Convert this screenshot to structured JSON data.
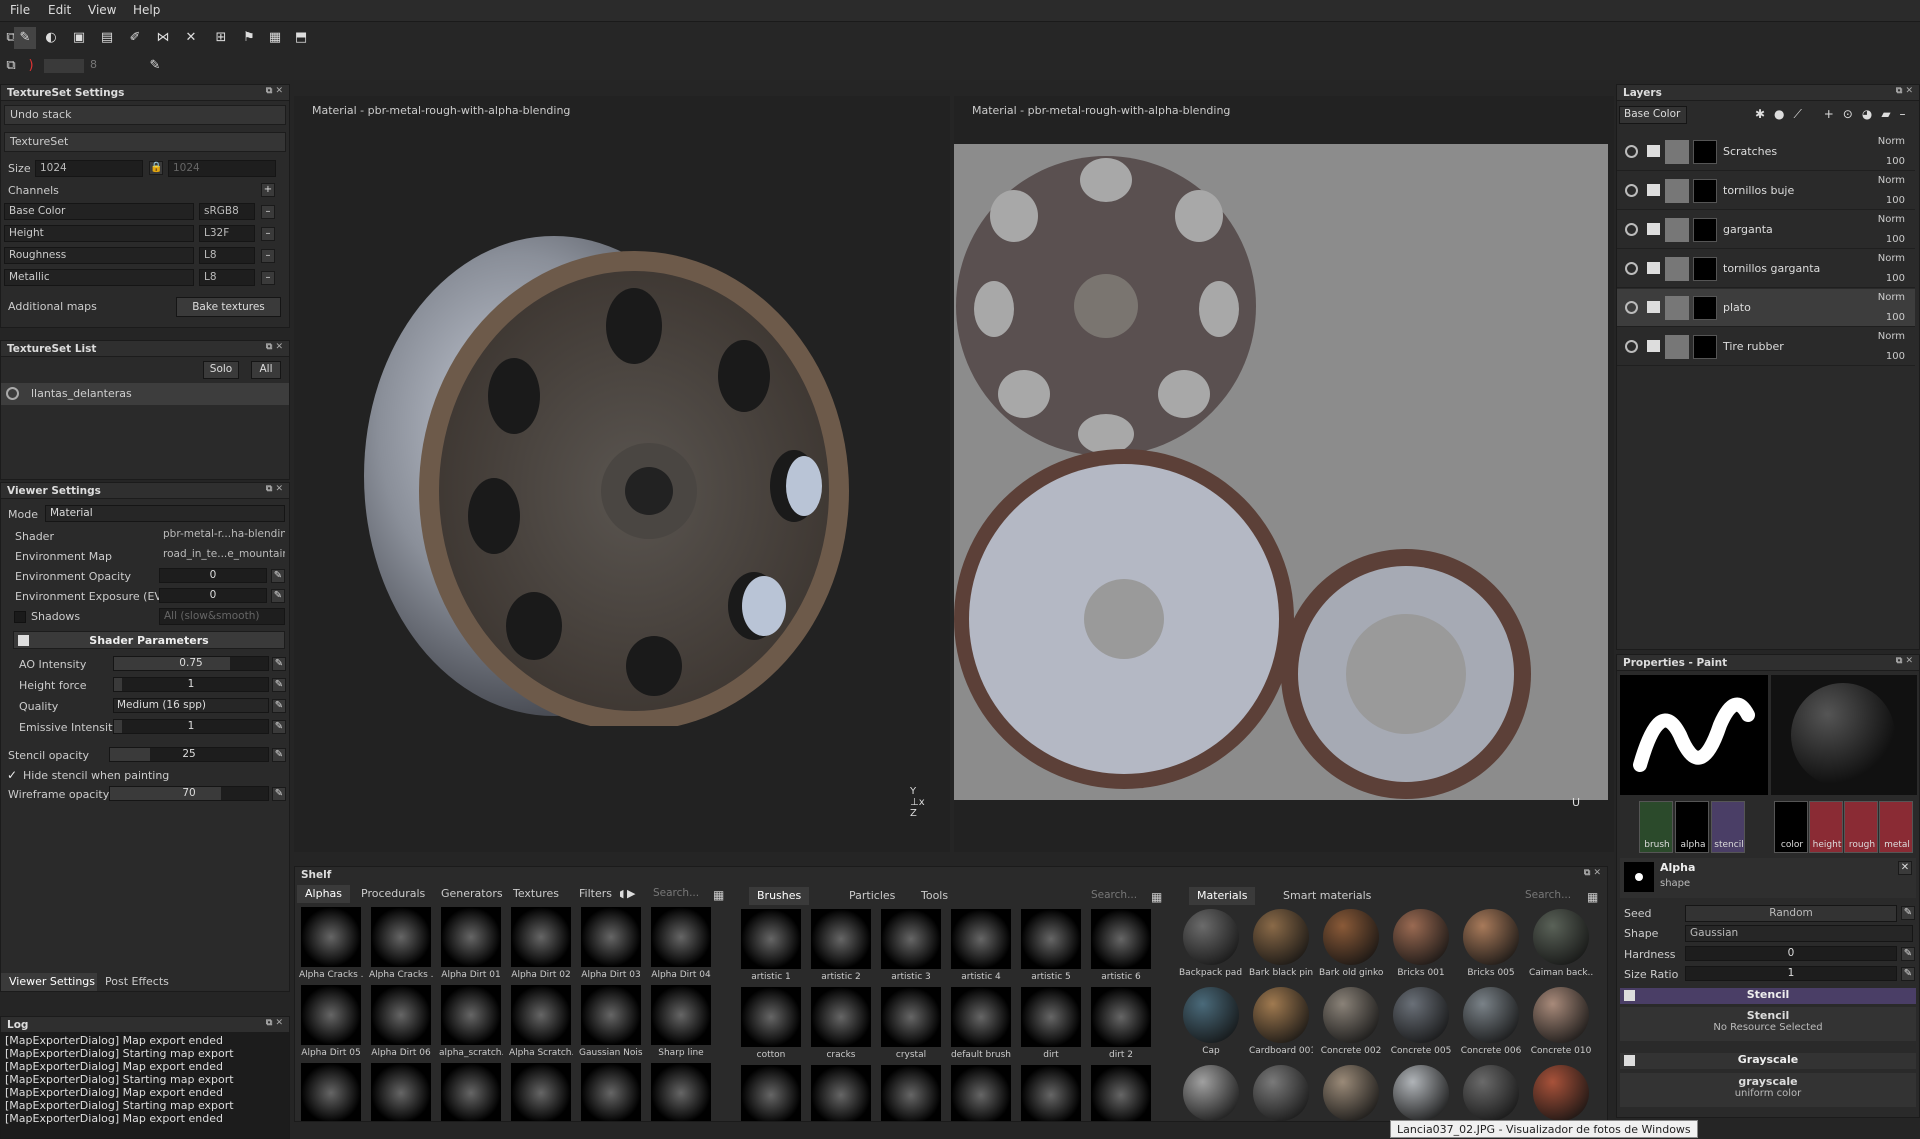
{
  "menu": [
    "File",
    "Edit",
    "View",
    "Help"
  ],
  "toolbar": {
    "brush_size": "8"
  },
  "textureset_settings": {
    "title": "TextureSet Settings",
    "undo_stack": "Undo stack",
    "textureset": "TextureSet",
    "size_label": "Size",
    "size_value": "1024",
    "size_value2": "1024",
    "channels_label": "Channels",
    "channels": [
      {
        "name": "Base Color",
        "format": "sRGB8"
      },
      {
        "name": "Height",
        "format": "L32F"
      },
      {
        "name": "Roughness",
        "format": "L8"
      },
      {
        "name": "Metallic",
        "format": "L8"
      }
    ],
    "additional_maps": "Additional maps",
    "bake_textures": "Bake textures"
  },
  "textureset_list": {
    "title": "TextureSet List",
    "solo": "Solo",
    "all": "All",
    "items": [
      "llantas_delanteras"
    ]
  },
  "viewer_settings": {
    "title": "Viewer Settings",
    "mode_label": "Mode",
    "mode_value": "Material",
    "shader_label": "Shader",
    "shader_value": "pbr-metal-r...ha-blending",
    "envmap_label": "Environment Map",
    "envmap_value": "road_in_te...e_mountain",
    "env_opacity_label": "Environment Opacity",
    "env_opacity_value": "0",
    "env_exposure_label": "Environment Exposure (EV)",
    "env_exposure_value": "0",
    "shadows_label": "Shadows",
    "shadows_value": "All (slow&smooth)",
    "shader_params": "Shader Parameters",
    "params": [
      {
        "name": "AO Intensity",
        "value": "0.75",
        "fill": 0.75
      },
      {
        "name": "Height force",
        "value": "1",
        "fill": 0.05
      },
      {
        "name": "Quality",
        "value": "Medium (16 spp)",
        "fill": 0
      },
      {
        "name": "Emissive Intensity",
        "value": "1",
        "fill": 0.05
      }
    ],
    "stencil_opacity_label": "Stencil opacity",
    "stencil_opacity_value": "25",
    "hide_stencil": "Hide stencil when painting",
    "wireframe_label": "Wireframe opacity",
    "wireframe_value": "70"
  },
  "bottom_tabs": [
    "Viewer Settings",
    "Post Effects"
  ],
  "log": {
    "title": "Log",
    "lines": [
      "[MapExporterDialog] Map export ended",
      "[MapExporterDialog] Starting map export",
      "[MapExporterDialog] Map export ended",
      "[MapExporterDialog] Starting map export",
      "[MapExporterDialog] Map export ended",
      "[MapExporterDialog] Starting map export",
      "[MapExporterDialog] Map export ended"
    ]
  },
  "viewport3d": {
    "title": "Material - pbr-metal-rough-with-alpha-blending"
  },
  "viewport2d": {
    "title": "Material - pbr-metal-rough-with-alpha-blending",
    "axis": "U"
  },
  "layers": {
    "title": "Layers",
    "channel": "Base Color",
    "items": [
      {
        "name": "Scratches",
        "blend": "Norm",
        "opacity": "100"
      },
      {
        "name": "tornillos buje",
        "blend": "Norm",
        "opacity": "100"
      },
      {
        "name": "garganta",
        "blend": "Norm",
        "opacity": "100"
      },
      {
        "name": "tornillos garganta",
        "blend": "Norm",
        "opacity": "100"
      },
      {
        "name": "plato",
        "blend": "Norm",
        "opacity": "100"
      },
      {
        "name": "Tire rubber",
        "blend": "Norm",
        "opacity": "100"
      }
    ]
  },
  "properties": {
    "title": "Properties - Paint",
    "slots_left": [
      "brush",
      "alpha",
      "stencil"
    ],
    "slots_right": [
      "color",
      "height",
      "rough",
      "metal"
    ],
    "alpha_title": "Alpha",
    "alpha_sub": "shape",
    "seed_label": "Seed",
    "seed_value": "Random",
    "shape_label": "Shape",
    "shape_value": "Gaussian",
    "hardness_label": "Hardness",
    "hardness_value": "0",
    "sizeratio_label": "Size Ratio",
    "sizeratio_value": "1",
    "stencil_header": "Stencil",
    "stencil_title": "Stencil",
    "stencil_sub": "No Resource Selected",
    "grayscale_header": "Grayscale",
    "grayscale_title": "grayscale",
    "grayscale_sub": "uniform color"
  },
  "shelf": {
    "title": "Shelf",
    "left_tabs": [
      "Alphas",
      "Procedurals",
      "Generators",
      "Textures",
      "Filters"
    ],
    "left_search": "Search...",
    "alphas": [
      "Alpha Cracks ...",
      "Alpha Cracks ...",
      "Alpha Dirt 01",
      "Alpha Dirt 02",
      "Alpha Dirt 03",
      "Alpha Dirt 04",
      "Alpha Dirt 05",
      "Alpha Dirt 06",
      "alpha_scratch...",
      "Alpha Scratch...",
      "Gaussian Noise",
      "Sharp line",
      "",
      "",
      "",
      "",
      "",
      ""
    ],
    "mid_tabs": [
      "Brushes",
      "Particles",
      "Tools"
    ],
    "mid_search": "Search...",
    "brushes": [
      "artistic 1",
      "artistic 2",
      "artistic 3",
      "artistic 4",
      "artistic 5",
      "artistic 6",
      "cotton",
      "cracks",
      "crystal",
      "default brush",
      "dirt",
      "dirt 2",
      "",
      "",
      "",
      "",
      "",
      ""
    ],
    "right_tabs": [
      "Materials",
      "Smart materials"
    ],
    "right_search": "Search...",
    "materials": [
      "Backpack pad...",
      "Bark black pine",
      "Bark old ginko",
      "Bricks 001",
      "Bricks 005",
      "Caiman back...",
      "Cap",
      "Cardboard 001",
      "Concrete 002",
      "Concrete 005",
      "Concrete 006",
      "Concrete 010",
      "",
      "",
      "",
      "",
      "",
      ""
    ]
  },
  "taskbar_tooltip": "Lancia037_02.JPG - Visualizador de fotos de Windows"
}
